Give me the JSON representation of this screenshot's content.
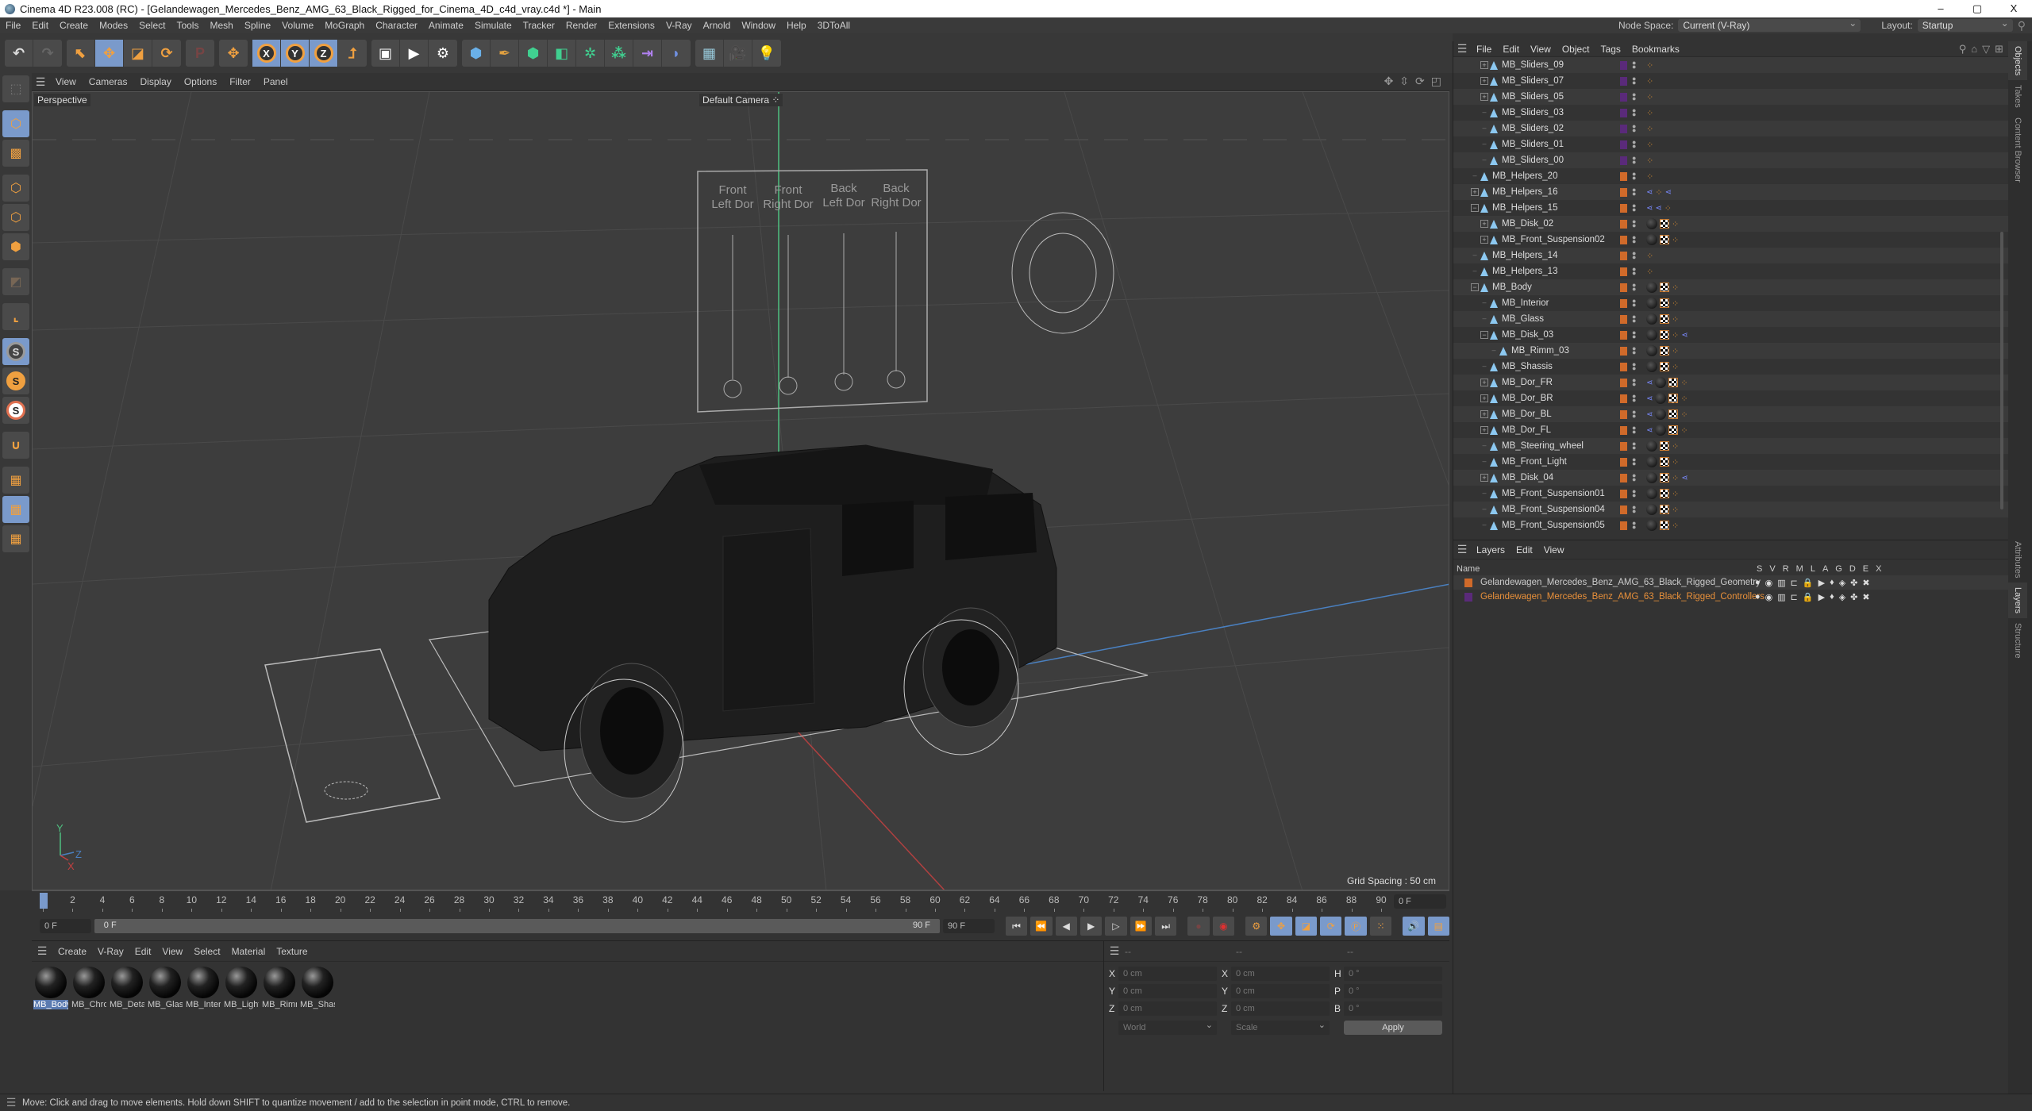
{
  "window": {
    "title": "Cinema 4D R23.008 (RC) - [Gelandewagen_Mercedes_Benz_AMG_63_Black_Rigged_for_Cinema_4D_c4d_vray.c4d *] - Main",
    "minimize": "–",
    "maximize": "▢",
    "close": "X"
  },
  "menubar": {
    "items": [
      "File",
      "Edit",
      "Create",
      "Modes",
      "Select",
      "Tools",
      "Mesh",
      "Spline",
      "Volume",
      "MoGraph",
      "Character",
      "Animate",
      "Simulate",
      "Tracker",
      "Render",
      "Extensions",
      "V-Ray",
      "Arnold",
      "Window",
      "Help",
      "3DToAll"
    ],
    "node_space_label": "Node Space:",
    "node_space_value": "Current (V-Ray)",
    "layout_label": "Layout:",
    "layout_value": "Startup"
  },
  "toolbar": {
    "undo": "↶",
    "redo": "↷",
    "tools": [
      "select-tool",
      "move-tool",
      "scale-tool",
      "rotate-tool"
    ],
    "axes": [
      "X",
      "Y",
      "Z"
    ]
  },
  "viewport": {
    "menu": [
      "View",
      "Cameras",
      "Display",
      "Options",
      "Filter",
      "Panel"
    ],
    "view_name": "Perspective",
    "camera_name": "Default Camera",
    "grid_spacing": "Grid Spacing : 50 cm",
    "rig_panel_labels": [
      "Front\nLeft Dor",
      "Front\nRight Dor",
      "Back\nLeft Dor",
      "Back\nRight Dor"
    ],
    "axis_labels": [
      "Y",
      "Z",
      "X"
    ]
  },
  "timeline": {
    "ticks": [
      0,
      2,
      4,
      6,
      8,
      10,
      12,
      14,
      16,
      18,
      20,
      22,
      24,
      26,
      28,
      30,
      32,
      34,
      36,
      38,
      40,
      42,
      44,
      46,
      48,
      50,
      52,
      54,
      56,
      58,
      60,
      62,
      64,
      66,
      68,
      70,
      72,
      74,
      76,
      78,
      80,
      82,
      84,
      86,
      88,
      90
    ],
    "current_frame": "0 F",
    "start_frame": "0 F",
    "range_start": "0 F",
    "range_end": "90 F",
    "end_frame": "90 F",
    "current_frame_right": "0 F"
  },
  "materials": {
    "menu": [
      "Create",
      "V-Ray",
      "Edit",
      "View",
      "Select",
      "Material",
      "Texture"
    ],
    "items": [
      {
        "name": "MB_Body",
        "selected": true
      },
      {
        "name": "MB_Chrome",
        "selected": false
      },
      {
        "name": "MB_Detail",
        "selected": false
      },
      {
        "name": "MB_Glass",
        "selected": false
      },
      {
        "name": "MB_Interior",
        "selected": false
      },
      {
        "name": "MB_Light",
        "selected": false
      },
      {
        "name": "MB_Rimm",
        "selected": false
      },
      {
        "name": "MB_Shassis",
        "selected": false
      }
    ]
  },
  "coordinates": {
    "headers": [
      "--",
      "--",
      "--"
    ],
    "position": {
      "X": "0 cm",
      "Y": "0 cm",
      "Z": "0 cm"
    },
    "size": {
      "X": "0 cm",
      "Y": "0 cm",
      "Z": "0 cm"
    },
    "rotation": {
      "H": "0 °",
      "P": "0 °",
      "B": "0 °"
    },
    "space_mode": "World",
    "size_mode": "Scale",
    "apply_label": "Apply"
  },
  "objects": {
    "menu": [
      "File",
      "Edit",
      "View",
      "Object",
      "Tags",
      "Bookmarks"
    ],
    "rows": [
      {
        "name": "MB_Sliders_09",
        "indent": 2,
        "exp": "+",
        "layer": "#5a2a7a",
        "tags": [
          "xp"
        ]
      },
      {
        "name": "MB_Sliders_07",
        "indent": 2,
        "exp": "+",
        "layer": "#5a2a7a",
        "tags": [
          "xp"
        ]
      },
      {
        "name": "MB_Sliders_05",
        "indent": 2,
        "exp": "+",
        "layer": "#5a2a7a",
        "tags": [
          "xp"
        ]
      },
      {
        "name": "MB_Sliders_03",
        "indent": 2,
        "exp": "",
        "layer": "#5a2a7a",
        "tags": [
          "xp"
        ]
      },
      {
        "name": "MB_Sliders_02",
        "indent": 2,
        "exp": "",
        "layer": "#5a2a7a",
        "tags": [
          "xp"
        ]
      },
      {
        "name": "MB_Sliders_01",
        "indent": 2,
        "exp": "",
        "layer": "#5a2a7a",
        "tags": [
          "xp"
        ]
      },
      {
        "name": "MB_Sliders_00",
        "indent": 2,
        "exp": "",
        "layer": "#5a2a7a",
        "tags": [
          "xp"
        ]
      },
      {
        "name": "MB_Helpers_20",
        "indent": 1,
        "exp": "",
        "layer": "#d06a2a",
        "tags": [
          "xp"
        ]
      },
      {
        "name": "MB_Helpers_16",
        "indent": 1,
        "exp": "+",
        "layer": "#d06a2a",
        "tags": [
          "ik",
          "xp",
          "ik"
        ]
      },
      {
        "name": "MB_Helpers_15",
        "indent": 1,
        "exp": "−",
        "layer": "#d06a2a",
        "tags": [
          "ik",
          "ik",
          "xp"
        ]
      },
      {
        "name": "MB_Disk_02",
        "indent": 2,
        "exp": "+",
        "layer": "#d06a2a",
        "tags": [
          "mat",
          "uv",
          "xp"
        ]
      },
      {
        "name": "MB_Front_Suspension02",
        "indent": 2,
        "exp": "+",
        "layer": "#d06a2a",
        "tags": [
          "mat",
          "uv",
          "xp"
        ]
      },
      {
        "name": "MB_Helpers_14",
        "indent": 1,
        "exp": "",
        "layer": "#d06a2a",
        "tags": [
          "xp"
        ]
      },
      {
        "name": "MB_Helpers_13",
        "indent": 1,
        "exp": "",
        "layer": "#d06a2a",
        "tags": [
          "xp"
        ]
      },
      {
        "name": "MB_Body",
        "indent": 1,
        "exp": "−",
        "layer": "#d06a2a",
        "tags": [
          "mat",
          "uv",
          "xp"
        ]
      },
      {
        "name": "MB_Interior",
        "indent": 2,
        "exp": "",
        "layer": "#d06a2a",
        "tags": [
          "mat",
          "uv",
          "xp"
        ]
      },
      {
        "name": "MB_Glass",
        "indent": 2,
        "exp": "",
        "layer": "#d06a2a",
        "tags": [
          "mat",
          "uv",
          "xp"
        ]
      },
      {
        "name": "MB_Disk_03",
        "indent": 2,
        "exp": "−",
        "layer": "#d06a2a",
        "tags": [
          "mat",
          "uv",
          "xp",
          "ik"
        ]
      },
      {
        "name": "MB_Rimm_03",
        "indent": 3,
        "exp": "",
        "layer": "#d06a2a",
        "tags": [
          "mat",
          "uv",
          "xp"
        ]
      },
      {
        "name": "MB_Shassis",
        "indent": 2,
        "exp": "",
        "layer": "#d06a2a",
        "tags": [
          "mat",
          "uv",
          "xp"
        ]
      },
      {
        "name": "MB_Dor_FR",
        "indent": 2,
        "exp": "+",
        "layer": "#d06a2a",
        "tags": [
          "ik",
          "mat",
          "uv",
          "xp"
        ]
      },
      {
        "name": "MB_Dor_BR",
        "indent": 2,
        "exp": "+",
        "layer": "#d06a2a",
        "tags": [
          "ik",
          "mat",
          "uv",
          "xp"
        ]
      },
      {
        "name": "MB_Dor_BL",
        "indent": 2,
        "exp": "+",
        "layer": "#d06a2a",
        "tags": [
          "ik",
          "mat",
          "uv",
          "xp"
        ]
      },
      {
        "name": "MB_Dor_FL",
        "indent": 2,
        "exp": "+",
        "layer": "#d06a2a",
        "tags": [
          "ik",
          "mat",
          "uv",
          "xp"
        ]
      },
      {
        "name": "MB_Steering_wheel",
        "indent": 2,
        "exp": "",
        "layer": "#d06a2a",
        "tags": [
          "mat",
          "uv",
          "xp"
        ]
      },
      {
        "name": "MB_Front_Light",
        "indent": 2,
        "exp": "",
        "layer": "#d06a2a",
        "tags": [
          "mat",
          "uv",
          "xp"
        ]
      },
      {
        "name": "MB_Disk_04",
        "indent": 2,
        "exp": "+",
        "layer": "#d06a2a",
        "tags": [
          "mat",
          "uv",
          "xp",
          "ik"
        ]
      },
      {
        "name": "MB_Front_Suspension01",
        "indent": 2,
        "exp": "",
        "layer": "#d06a2a",
        "tags": [
          "mat",
          "uv",
          "xp"
        ]
      },
      {
        "name": "MB_Front_Suspension04",
        "indent": 2,
        "exp": "",
        "layer": "#d06a2a",
        "tags": [
          "mat",
          "uv",
          "xp"
        ]
      },
      {
        "name": "MB_Front_Suspension05",
        "indent": 2,
        "exp": "",
        "layer": "#d06a2a",
        "tags": [
          "mat",
          "uv",
          "xp"
        ]
      }
    ]
  },
  "layers": {
    "menu": [
      "Layers",
      "Edit",
      "View"
    ],
    "columns": [
      "Name",
      "S",
      "V",
      "R",
      "M",
      "L",
      "A",
      "G",
      "D",
      "E",
      "X"
    ],
    "rows": [
      {
        "name": "Gelandewagen_Mercedes_Benz_AMG_63_Black_Rigged_Geometry",
        "color": "#d06a2a",
        "text_color": "#cccccc"
      },
      {
        "name": "Gelandewagen_Mercedes_Benz_AMG_63_Black_Rigged_Controllers",
        "color": "#5a2a7a",
        "text_color": "#e8903a"
      }
    ]
  },
  "side_tabs": {
    "top": [
      "Objects",
      "Takes",
      "Content Browser"
    ],
    "bottom": [
      "Attributes",
      "Layers",
      "Structure"
    ]
  },
  "status": {
    "text": "Move: Click and drag to move elements. Hold down SHIFT to quantize movement / add to the selection in point mode, CTRL to remove."
  }
}
